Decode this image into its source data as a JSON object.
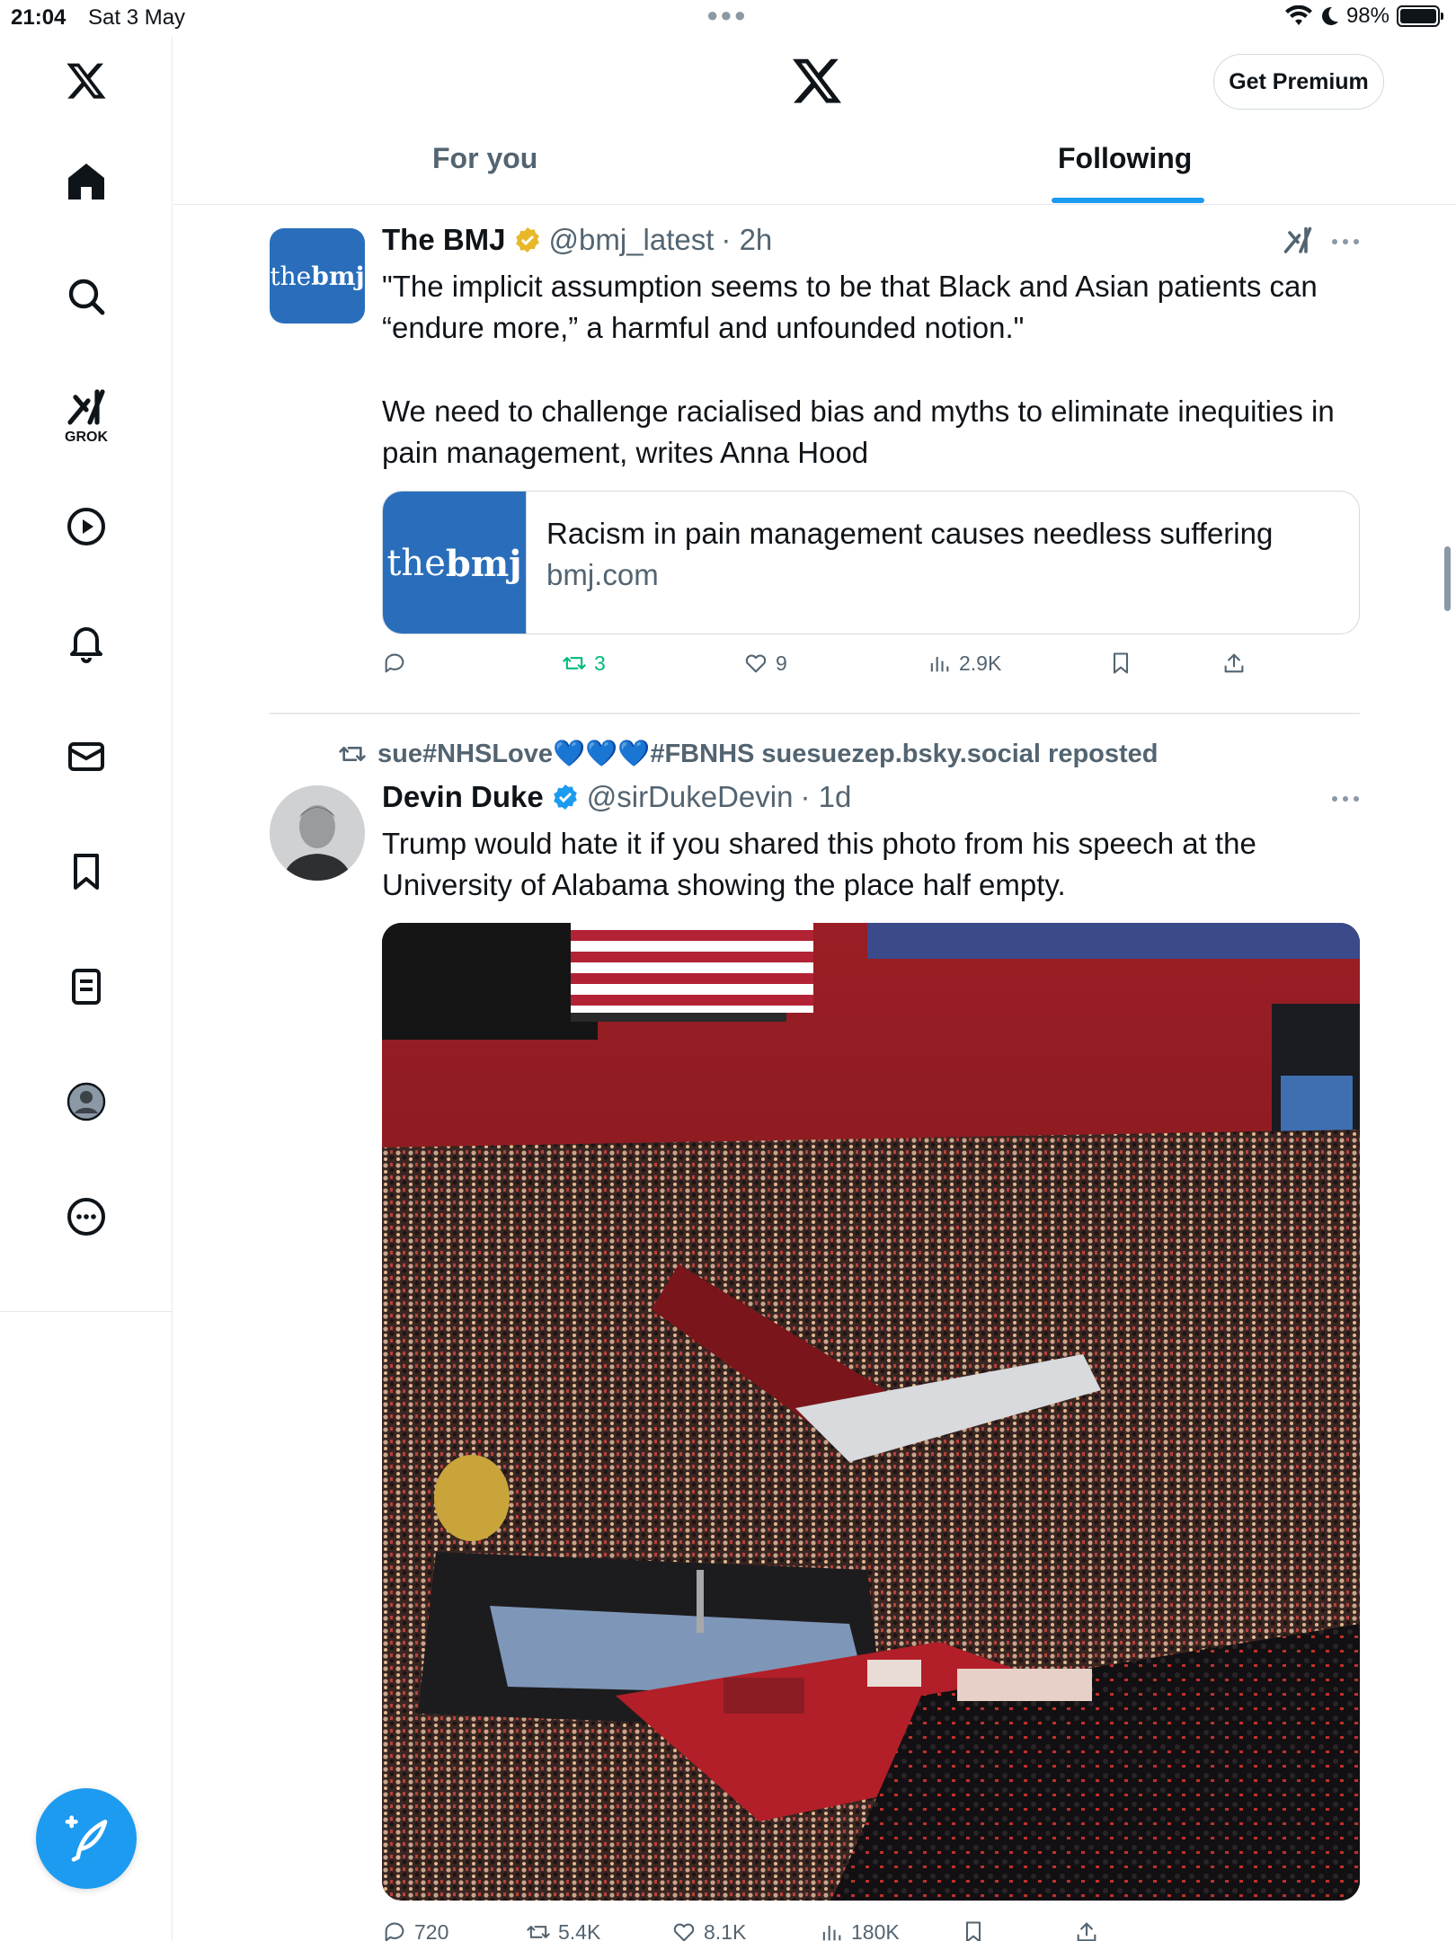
{
  "status_bar": {
    "time": "21:04",
    "date": "Sat 3 May",
    "battery": "98%"
  },
  "sidebar": {
    "items": [
      {
        "name": "home",
        "icon": "home-icon"
      },
      {
        "name": "explore",
        "icon": "search-icon"
      },
      {
        "name": "grok",
        "icon": "grok-icon",
        "label": "GROK"
      },
      {
        "name": "video",
        "icon": "play-icon"
      },
      {
        "name": "notifications",
        "icon": "bell-icon"
      },
      {
        "name": "messages",
        "icon": "mail-icon"
      },
      {
        "name": "bookmarks",
        "icon": "bookmark-icon"
      },
      {
        "name": "lists",
        "icon": "list-icon"
      },
      {
        "name": "profile",
        "icon": "profile-icon"
      },
      {
        "name": "more",
        "icon": "more-icon"
      }
    ],
    "compose_icon": "compose-icon"
  },
  "header": {
    "premium_label": "Get Premium",
    "tabs": [
      {
        "label": "For you",
        "active": false
      },
      {
        "label": "Following",
        "active": true
      }
    ]
  },
  "tweets": [
    {
      "name": "The BMJ",
      "handle": "@bmj_latest",
      "time": "· 2h",
      "verified": "gold",
      "avatar_text_a": "the",
      "avatar_text_b": "bmj",
      "text_1": "\"The implicit assumption seems to be that Black and Asian patients can “endure more,” a harmful and unfounded notion.\"",
      "text_2": "We need to challenge racialised bias and myths to eliminate inequities in pain management, writes Anna Hood",
      "card": {
        "title": "Racism in pain management causes needless suffering",
        "domain": "bmj.com"
      },
      "actions": {
        "replies": "",
        "reposts": "3",
        "likes": "9",
        "views": "2.9K"
      }
    },
    {
      "reposted_by": "sue#NHSLove💙💙💙#FBNHS suesuezep.bsky.social reposted",
      "name": "Devin Duke",
      "handle": "@sirDukeDevin",
      "time": "· 1d",
      "verified": "blue",
      "text": "Trump would hate it if you shared this photo from his speech at the University of Alabama showing the place half empty.",
      "actions": {
        "replies": "720",
        "reposts": "5.4K",
        "likes": "8.1K",
        "views": "180K"
      }
    }
  ],
  "colors": {
    "accent": "#1d9bf0",
    "repost_green": "#00ba7c",
    "secondary_text": "#536471",
    "bmj_blue": "#2a6ebb",
    "gold_badge": "#e8b829"
  }
}
